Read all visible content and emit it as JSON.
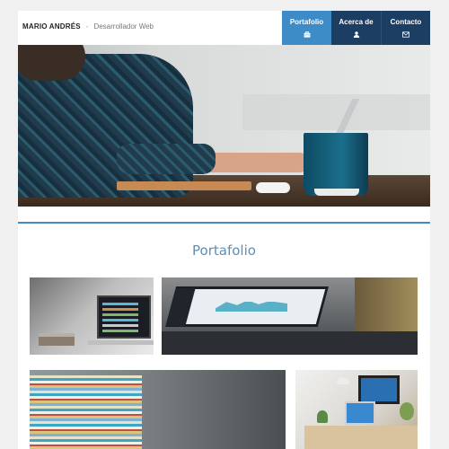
{
  "header": {
    "brand_name": "MARIO ANDRÉS",
    "separator": "-",
    "role": "Desarrollador Web"
  },
  "nav": {
    "items": [
      {
        "label": "Portafolio",
        "icon": "briefcase-icon",
        "active": true,
        "color": "#3d8cc7"
      },
      {
        "label": "Acerca de",
        "icon": "user-icon",
        "active": false,
        "color": "#1c3e62"
      },
      {
        "label": "Contacto",
        "icon": "envelope-icon",
        "active": false,
        "color": "#1c3e62"
      }
    ]
  },
  "colors": {
    "accent": "#3d8cc7",
    "nav_dark": "#1c3e62",
    "section_title": "#5a8fb8"
  },
  "portfolio": {
    "title": "Portafolio"
  }
}
